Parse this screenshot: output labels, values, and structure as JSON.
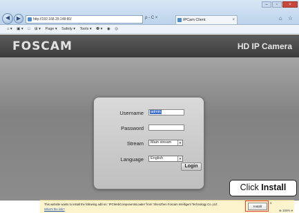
{
  "browser": {
    "back_icon": "back-arrow-icon",
    "forward_icon": "forward-arrow-icon",
    "address": "http://192.168.29.148:80/",
    "address_tools": "ρ - C ×",
    "tab_title": "IPCam Client",
    "tab_close": "×",
    "right_tools": "⌂ ☆",
    "window_controls": [
      "–",
      "▫",
      "×"
    ]
  },
  "command_bar": {
    "items": [
      "⌂ ▾",
      "▣ ▾",
      "□",
      "⊞ ▾",
      "Page ▾",
      "Safety ▾",
      "Tools ▾",
      "❷ ▾",
      "◉",
      "◎"
    ]
  },
  "page": {
    "logo": "FOSCAM",
    "product": "HD IP Camera"
  },
  "login": {
    "username_label": "Username",
    "username_value": "admin",
    "password_label": "Password",
    "password_value": "",
    "stream_label": "Stream",
    "stream_value": "Main stream",
    "language_label": "Language",
    "language_value": "English",
    "login_button": "Login"
  },
  "callout": {
    "prefix": "Click ",
    "action": "Install"
  },
  "notification": {
    "message": "This website wants to install the following add-on: 'IPCWebComponentsLoader' from 'ShenZhen Foscam Intelligent Technology Co.,Ltd'.",
    "link": "What's the risk?",
    "install_button": "Install",
    "close": "×",
    "zoom": "⊕ 100% ▾"
  }
}
